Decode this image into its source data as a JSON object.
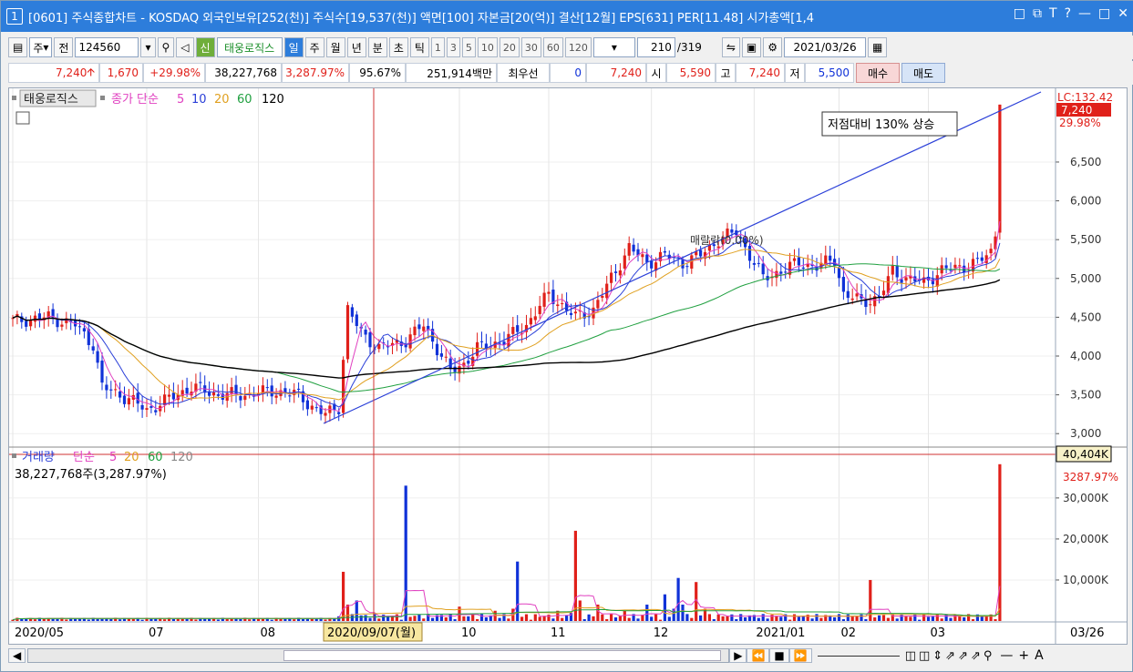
{
  "title": {
    "num": "1",
    "text": "[0601] 주식종합차트 - KOSDAQ 외국인보유[252(천)] 주식수[19,537(천)] 액면[100] 자본금[20(억)] 결산[12월] EPS[631] PER[11.48] 시가총액[1,4"
  },
  "toolbar": {
    "mode": "주",
    "prev": "전",
    "code": "124560",
    "sin_badge": "신",
    "stock_name": "태웅로직스",
    "periods": [
      "일",
      "주",
      "월",
      "년",
      "분",
      "초",
      "틱"
    ],
    "selected_period": "일",
    "intervals": [
      "1",
      "3",
      "5",
      "10",
      "20",
      "30",
      "60",
      "120"
    ],
    "count": "210",
    "total": "/319",
    "date": "2021/03/26"
  },
  "quote": {
    "price": "7,240",
    "change": "1,670",
    "change_pct": "+29.98%",
    "volume": "38,227,768",
    "vol_pct": "3,287.97%",
    "ratio": "95.67%",
    "amount": "251,914백만",
    "best_label": "최우선",
    "best_val": "0",
    "best_price": "7,240",
    "open_label": "시",
    "open": "5,590",
    "high_label": "고",
    "high": "7,240",
    "low_label": "저",
    "low": "5,500",
    "buy": "매수",
    "sell": "매도"
  },
  "price_panel": {
    "legend": [
      "태웅로직스",
      "종가 단순",
      "5",
      "10",
      "20",
      "60",
      "120"
    ],
    "annotation": "저점대비 130% 상승",
    "tag_top": "LC:132.42",
    "tag_price": "7,240",
    "tag_pct": "29.98%",
    "mid_label": "매랄락(0.00%)"
  },
  "volume_panel": {
    "legend": [
      "거래량",
      "단순",
      "5",
      "20",
      "60",
      "120"
    ],
    "value_text": "38,227,768주(3,287.97%)",
    "tag_value": "40,404K",
    "tag_pct": "3287.97%"
  },
  "bottom": {
    "cursor_date": "2020/09/07(월)",
    "end_label": "03/26"
  },
  "colors": {
    "up": "#e0201a",
    "down": "#1032d8",
    "ma5": "#e040c0",
    "ma10": "#2a3fd8",
    "ma20": "#e0a020",
    "ma60": "#20a040",
    "ma120": "#000000",
    "trend": "#2a3fd8",
    "cursor": "#d03030"
  },
  "chart_data": [
    {
      "type": "candlestick",
      "title": "태웅로직스",
      "xlabel": "",
      "ylabel": "",
      "ylim": [
        2850,
        7450
      ],
      "x_ticks": [
        "2020/05",
        "07",
        "08",
        "10",
        "11",
        "12",
        "2021/01",
        "02",
        "03"
      ],
      "y_ticks": [
        3000,
        3500,
        4000,
        4500,
        5000,
        5500,
        6000,
        6500
      ],
      "y_tick_labels": [
        "3,000",
        "3,500",
        "4,000",
        "4,500",
        "5,000",
        "5,500",
        "6,000",
        "6,500"
      ],
      "anchors_close": [
        [
          0,
          4450
        ],
        [
          8,
          4500
        ],
        [
          14,
          4400
        ],
        [
          18,
          4150
        ],
        [
          20,
          3600
        ],
        [
          26,
          3450
        ],
        [
          30,
          3300
        ],
        [
          35,
          3450
        ],
        [
          40,
          3600
        ],
        [
          46,
          3500
        ],
        [
          52,
          3500
        ],
        [
          58,
          3550
        ],
        [
          64,
          3500
        ],
        [
          68,
          3300
        ],
        [
          70,
          3250
        ],
        [
          73,
          3350
        ],
        [
          75,
          4600
        ],
        [
          78,
          4300
        ],
        [
          82,
          4100
        ],
        [
          88,
          4200
        ],
        [
          92,
          4400
        ],
        [
          95,
          4100
        ],
        [
          98,
          3800
        ],
        [
          101,
          3900
        ],
        [
          104,
          4100
        ],
        [
          110,
          4200
        ],
        [
          115,
          4400
        ],
        [
          120,
          4800
        ],
        [
          126,
          4500
        ],
        [
          130,
          4600
        ],
        [
          134,
          5000
        ],
        [
          138,
          5400
        ],
        [
          142,
          5200
        ],
        [
          146,
          5300
        ],
        [
          150,
          5200
        ],
        [
          154,
          5300
        ],
        [
          158,
          5500
        ],
        [
          162,
          5600
        ],
        [
          165,
          5300
        ],
        [
          168,
          5000
        ],
        [
          172,
          5100
        ],
        [
          176,
          5200
        ],
        [
          180,
          5150
        ],
        [
          184,
          5250
        ],
        [
          186,
          4800
        ],
        [
          190,
          4700
        ],
        [
          194,
          4750
        ],
        [
          197,
          5100
        ],
        [
          200,
          5000
        ],
        [
          204,
          4950
        ],
        [
          208,
          5100
        ],
        [
          212,
          5150
        ],
        [
          216,
          5200
        ],
        [
          219,
          5350
        ],
        [
          220,
          5590
        ],
        [
          221,
          7240
        ]
      ],
      "series": [
        {
          "name": "5",
          "values": []
        },
        {
          "name": "10",
          "values": []
        },
        {
          "name": "20",
          "values": []
        },
        {
          "name": "60",
          "values": []
        },
        {
          "name": "120",
          "values": []
        }
      ]
    },
    {
      "type": "bar",
      "title": "거래량",
      "ylim": [
        0,
        40404
      ],
      "y_ticks": [
        10000,
        20000,
        30000
      ],
      "y_tick_labels": [
        "10,000K",
        "20,000K",
        "30,000K"
      ],
      "spikes": [
        [
          74,
          12000
        ],
        [
          75,
          4000
        ],
        [
          77,
          5000
        ],
        [
          88,
          33000
        ],
        [
          96,
          1500
        ],
        [
          100,
          3500
        ],
        [
          108,
          2500
        ],
        [
          112,
          3000
        ],
        [
          113,
          14500
        ],
        [
          122,
          2500
        ],
        [
          125,
          2000
        ],
        [
          126,
          22000
        ],
        [
          127,
          5000
        ],
        [
          131,
          4000
        ],
        [
          137,
          2500
        ],
        [
          142,
          4000
        ],
        [
          146,
          6500
        ],
        [
          148,
          3000
        ],
        [
          149,
          10500
        ],
        [
          150,
          4000
        ],
        [
          153,
          9500
        ],
        [
          155,
          3000
        ],
        [
          192,
          10000
        ],
        [
          221,
          38228
        ]
      ]
    }
  ]
}
